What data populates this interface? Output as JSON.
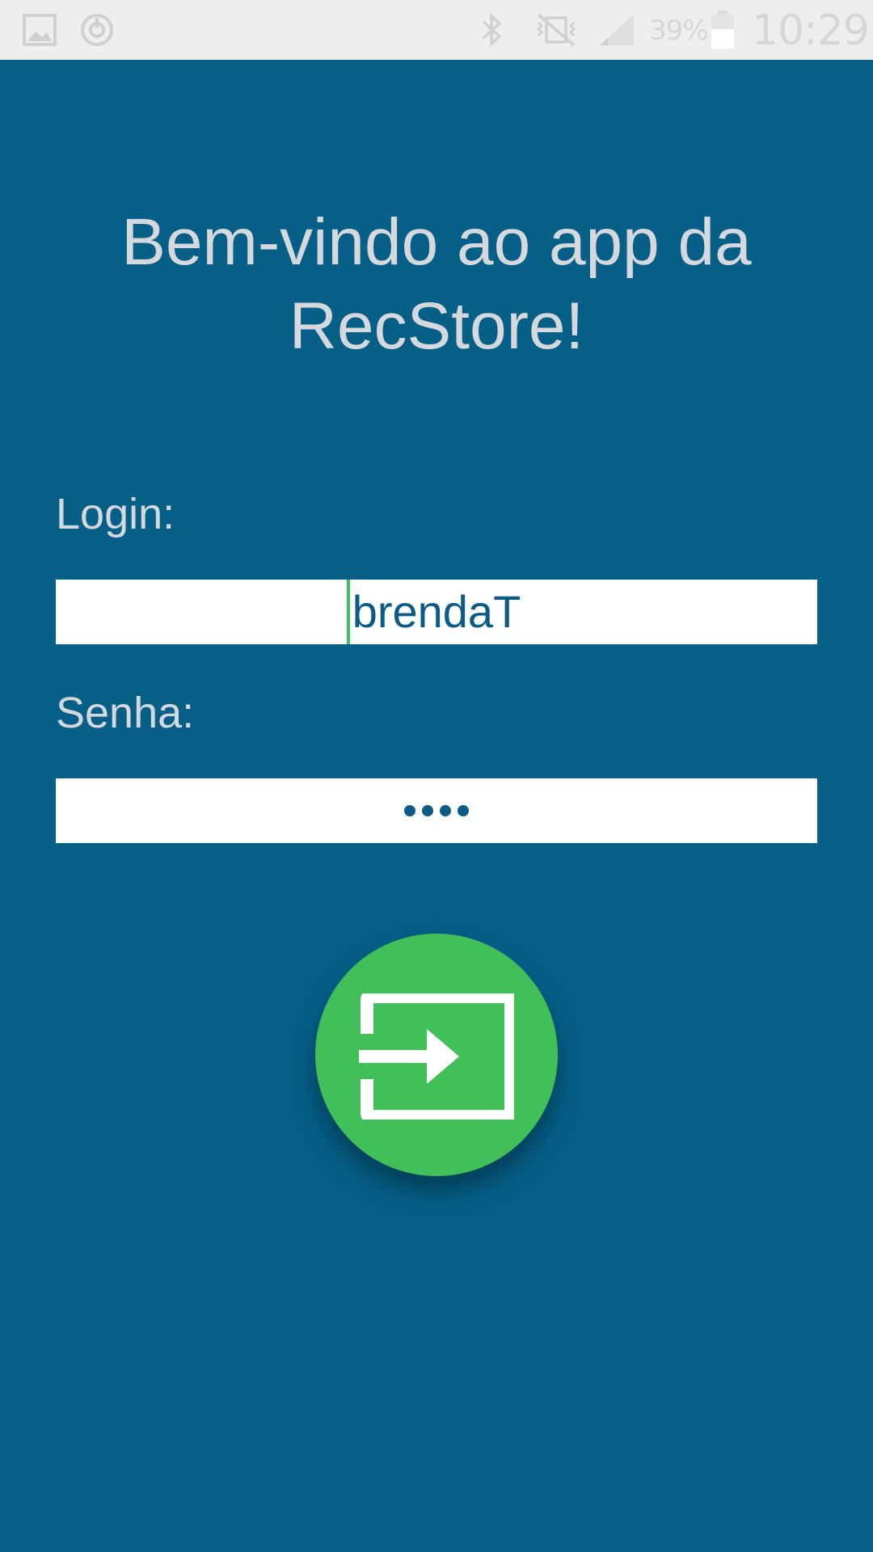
{
  "status_bar": {
    "battery_percent": "39%",
    "time": "10:29",
    "icons": [
      "image-icon",
      "sync-icon",
      "bluetooth-icon",
      "vibrate-icon",
      "signal-icon",
      "battery-icon"
    ]
  },
  "app": {
    "title": "Bem-vindo ao app da RecStore!"
  },
  "form": {
    "login_label": "Login:",
    "login_value": "brendaT",
    "password_label": "Senha:",
    "password_masked": "••••",
    "password_length": 4
  },
  "submit_button": {
    "icon": "login-icon"
  },
  "colors": {
    "background": "#055f87",
    "status_bar": "#eeeeee",
    "accent": "#41bf58",
    "text_light": "#d5d8dc",
    "input_text": "#0b5b86"
  }
}
